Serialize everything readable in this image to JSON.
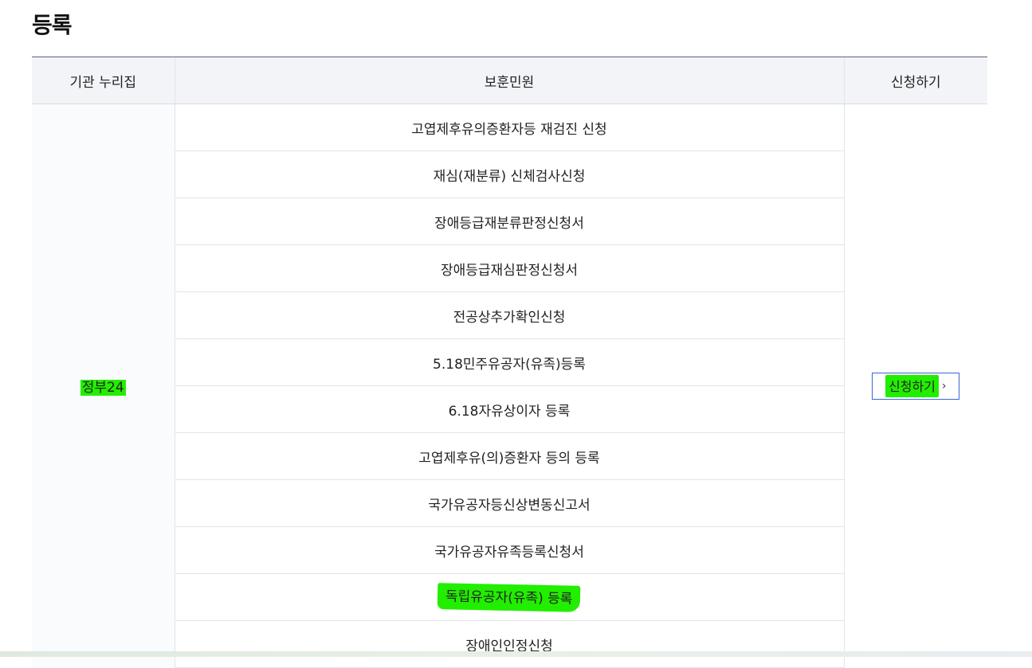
{
  "page_title": "등록",
  "table": {
    "headers": {
      "agency": "기관 누리집",
      "service": "보훈민원",
      "action": "신청하기"
    },
    "agency": "정부24",
    "services": [
      "고엽제후유의증환자등 재검진 신청",
      "재심(재분류) 신체검사신청",
      "장애등급재분류판정신청서",
      "장애등급재심판정신청서",
      "전공상추가확인신청",
      "5.18민주유공자(유족)등록",
      "6.18자유상이자 등록",
      "고엽제후유(의)증환자 등의 등록",
      "국가유공자등신상변동신고서",
      "국가유공자유족등록신청서",
      "독립유공자(유족) 등록",
      "장애인인정신청"
    ],
    "apply_button": "신청하기",
    "apply_icon": "chevron-right-icon",
    "highlight_color": "#22ee00"
  }
}
